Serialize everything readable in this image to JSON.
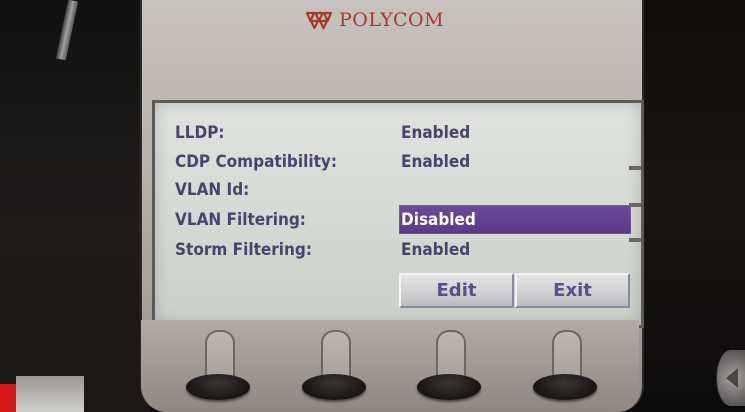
{
  "brand": {
    "name": "POLYCOM",
    "color": "#a43b2e",
    "icon": "polycom-logo-icon"
  },
  "settings": {
    "rows": [
      {
        "label": "LLDP:",
        "value": "Enabled",
        "selected": false
      },
      {
        "label": "CDP Compatibility:",
        "value": "Enabled",
        "selected": false
      },
      {
        "label": "VLAN Id:",
        "value": "",
        "selected": false
      },
      {
        "label": "VLAN Filtering:",
        "value": "Disabled",
        "selected": true
      },
      {
        "label": "Storm Filtering:",
        "value": "Enabled",
        "selected": false
      }
    ]
  },
  "softkeys": {
    "edit_label": "Edit",
    "exit_label": "Exit"
  },
  "colors": {
    "screen_text": "#4a4568",
    "selection": "#5b3a88",
    "softkey_text": "#5a4f88"
  }
}
